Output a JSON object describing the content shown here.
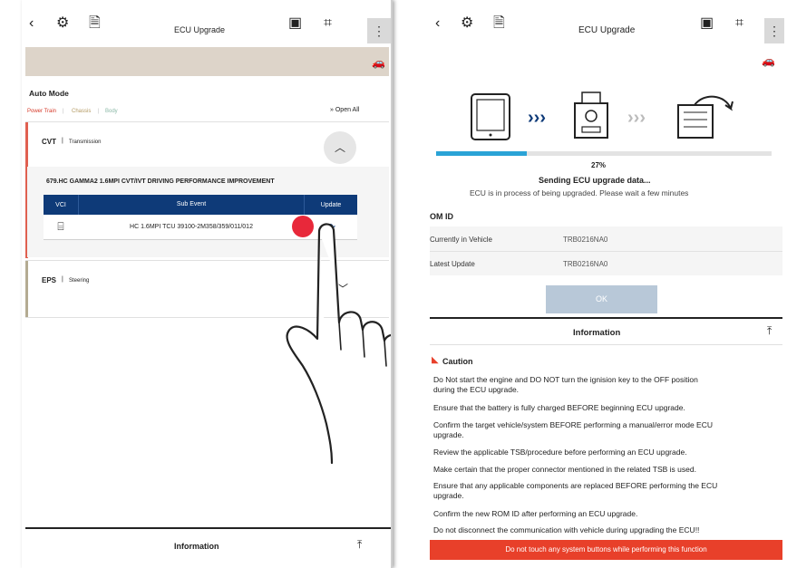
{
  "left": {
    "header": {
      "title": "ECU Upgrade"
    },
    "mode_title": "Auto Mode",
    "categories": {
      "power_train": "Power Train",
      "chassis": "Chassis",
      "body": "Body"
    },
    "open_all": "Open All",
    "cvt": {
      "name": "CVT",
      "sub": "Transmission"
    },
    "event_title": "679.HC GAMMA2 1.6MPI CVT/IVT DRIVING PERFORMANCE IMPROVEMENT",
    "table": {
      "headers": [
        "VCI",
        "Sub Event",
        "Update"
      ],
      "row": {
        "sub_event": "HC 1.6MPI TCU 39100-2M358/359/011/012"
      }
    },
    "eps": {
      "name": "EPS",
      "sub": "Steering"
    },
    "footer": {
      "label": "Information"
    }
  },
  "right": {
    "header": {
      "title": "ECU Upgrade"
    },
    "progress": {
      "percent_text": "27%",
      "value": 0.27
    },
    "status_main": "Sending ECU upgrade data...",
    "status_sub": "ECU is in process of being upgraded. Please wait a few minutes",
    "rom_id_label": "OM ID",
    "currently_label": "Currently in Vehicle",
    "currently_value": "TRB0216NA0",
    "latest_label": "Latest Update",
    "latest_value": "TRB0216NA0",
    "ok_label": "OK",
    "info_label": "Information",
    "caution_title": "Caution",
    "caution_lines": [
      "Do Not start the engine and DO NOT turn the ignision key to the OFF position",
      "during the ECU upgrade.",
      "Ensure that the battery is fully charged BEFORE beginning ECU upgrade.",
      "Confirm the target vehicle/system BEFORE performing a manual/error mode ECU",
      "upgrade.",
      "Review the applicable TSB/procedure before performing an ECU upgrade.",
      "Make certain that the proper connector mentioned in the related TSB is used.",
      "Ensure that any applicable components are replaced BEFORE performing the ECU",
      "upgrade.",
      "Confirm the new ROM ID after performing an ECU upgrade.",
      "Do not disconnect the communication with vehicle during upgrading the ECU!!"
    ],
    "warning": "Do not touch any system buttons while performing this function"
  },
  "colors": {
    "accent_red": "#e8402a",
    "navy": "#0e3a78",
    "progress": "#2aa3d6"
  },
  "icons": [
    "back-arrow-icon",
    "settings-gear-icon",
    "car-document-icon",
    "vci-device-icon",
    "capture-icon",
    "more-vert-icon",
    "car-settings-icon",
    "expand-icon"
  ]
}
